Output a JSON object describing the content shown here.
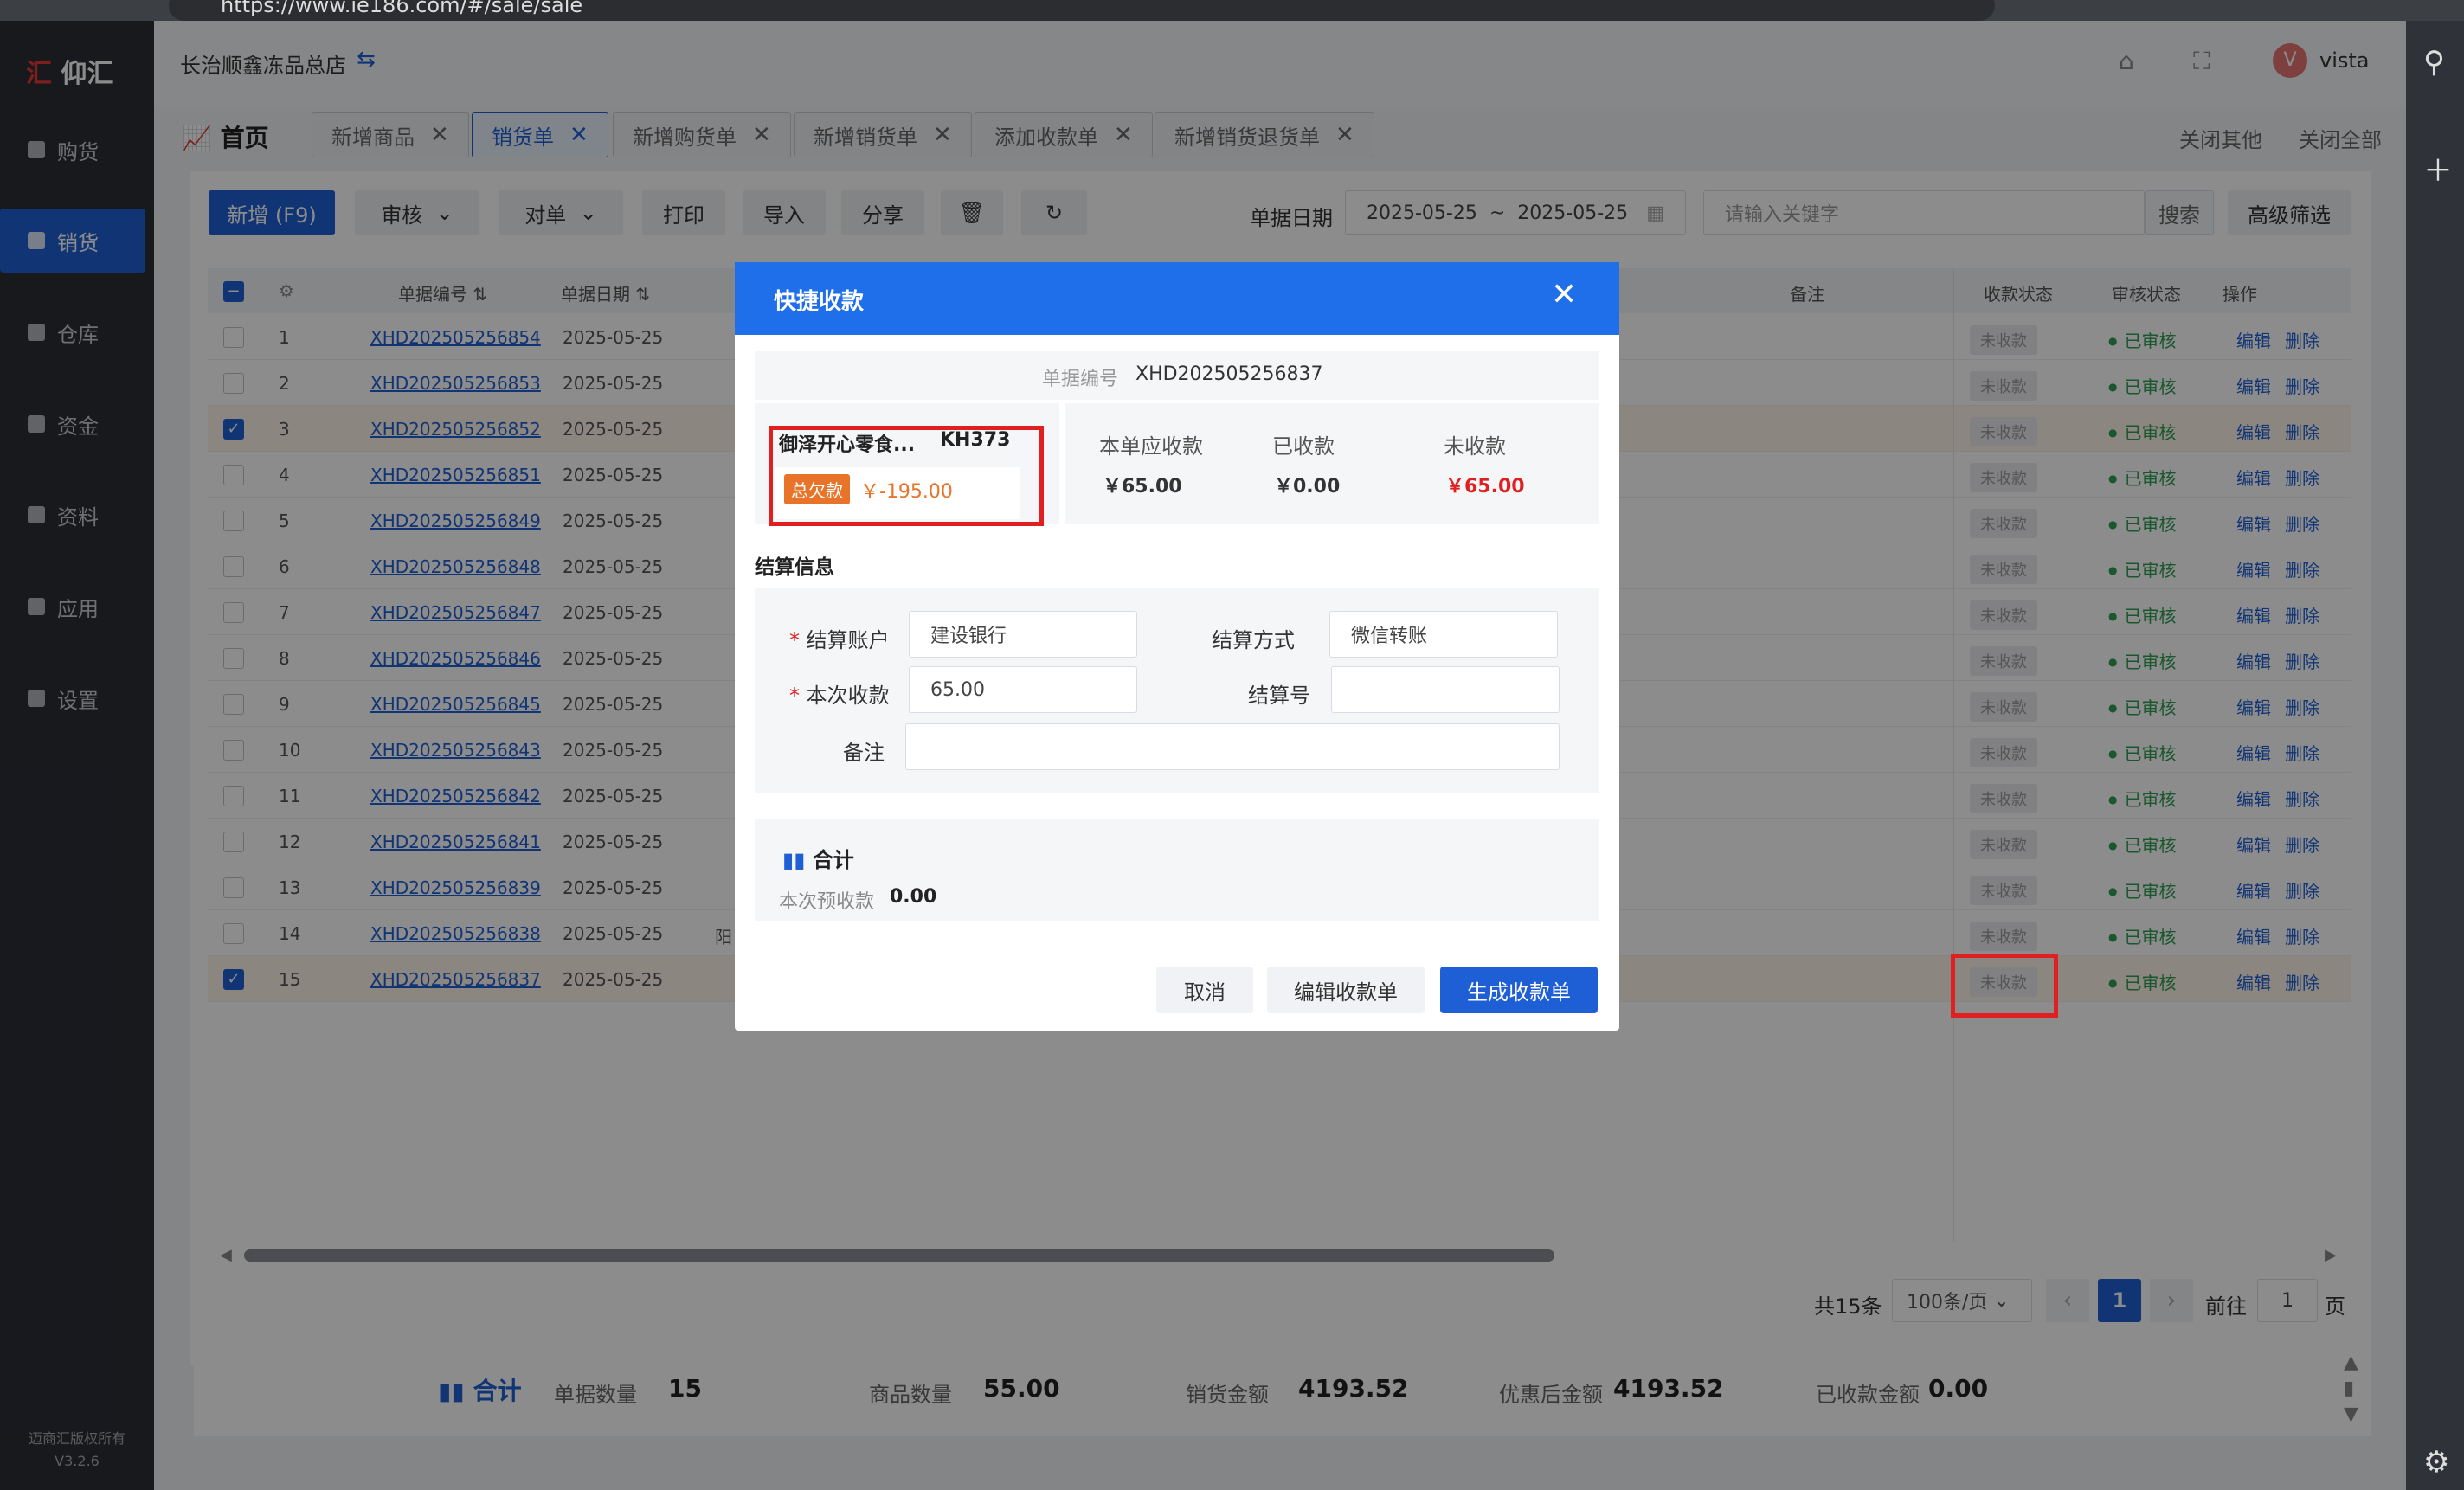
{
  "browser": {
    "url": "https://www.ie186.com/#/sale/sale"
  },
  "app": {
    "logo": "仰汇",
    "copyright": "迈商汇版权所有",
    "version": "V3.2.6"
  },
  "sidebar": {
    "items": [
      {
        "label": "购货"
      },
      {
        "label": "销货"
      },
      {
        "label": "仓库"
      },
      {
        "label": "资金"
      },
      {
        "label": "资料"
      },
      {
        "label": "应用"
      },
      {
        "label": "设置"
      }
    ]
  },
  "header": {
    "store": "长治顺鑫冻品总店",
    "user_initial": "V",
    "username": "vista"
  },
  "tabs": {
    "home": "首页",
    "items": [
      {
        "label": "新增商品"
      },
      {
        "label": "销货单"
      },
      {
        "label": "新增购货单"
      },
      {
        "label": "新增销货单"
      },
      {
        "label": "添加收款单"
      },
      {
        "label": "新增销货退货单"
      }
    ],
    "close_others": "关闭其他",
    "close_all": "关闭全部"
  },
  "toolbar": {
    "add": "新增 (F9)",
    "audit": "审核",
    "reconcile": "对单",
    "print": "打印",
    "import": "导入",
    "share": "分享",
    "date_label": "单据日期",
    "date_from": "2025-05-25",
    "date_sep": "~",
    "date_to": "2025-05-25",
    "keyword_placeholder": "请输入关键字",
    "search": "搜索",
    "advanced": "高级筛选"
  },
  "table": {
    "headers": {
      "no": "单据编号",
      "date": "单据日期",
      "remark": "备注",
      "pay_status": "收款状态",
      "audit_status": "审核状态",
      "ops": "操作"
    },
    "edit": "编辑",
    "delete": "删除",
    "status": "未收款",
    "audited": "已审核",
    "rows": [
      {
        "idx": "1",
        "no": "XHD202505256854",
        "date": "2025-05-25",
        "checked": false
      },
      {
        "idx": "2",
        "no": "XHD202505256853",
        "date": "2025-05-25",
        "checked": false
      },
      {
        "idx": "3",
        "no": "XHD202505256852",
        "date": "2025-05-25",
        "checked": true
      },
      {
        "idx": "4",
        "no": "XHD202505256851",
        "date": "2025-05-25",
        "checked": false
      },
      {
        "idx": "5",
        "no": "XHD202505256849",
        "date": "2025-05-25",
        "checked": false
      },
      {
        "idx": "6",
        "no": "XHD202505256848",
        "date": "2025-05-25",
        "checked": false
      },
      {
        "idx": "7",
        "no": "XHD202505256847",
        "date": "2025-05-25",
        "checked": false
      },
      {
        "idx": "8",
        "no": "XHD202505256846",
        "date": "2025-05-25",
        "checked": false
      },
      {
        "idx": "9",
        "no": "XHD202505256845",
        "date": "2025-05-25",
        "checked": false
      },
      {
        "idx": "10",
        "no": "XHD202505256843",
        "date": "2025-05-25",
        "checked": false
      },
      {
        "idx": "11",
        "no": "XHD202505256842",
        "date": "2025-05-25",
        "checked": false
      },
      {
        "idx": "12",
        "no": "XHD202505256841",
        "date": "2025-05-25",
        "checked": false
      },
      {
        "idx": "13",
        "no": "XHD202505256839",
        "date": "2025-05-25",
        "checked": false
      },
      {
        "idx": "14",
        "no": "XHD202505256838",
        "date": "2025-05-25",
        "checked": false,
        "remark": "阳"
      },
      {
        "idx": "15",
        "no": "XHD202505256837",
        "date": "2025-05-25",
        "checked": true
      }
    ]
  },
  "pagination": {
    "total": "共15条",
    "page_size": "100条/页",
    "current": "1",
    "goto_label": "前往",
    "goto_value": "1",
    "page_unit": "页"
  },
  "summary": {
    "title": "合计",
    "doc_count_label": "单据数量",
    "doc_count": "15",
    "qty_label": "商品数量",
    "qty": "55.00",
    "sales_label": "销货金额",
    "sales": "4193.52",
    "discounted_label": "优惠后金额",
    "discounted": "4193.52",
    "received_label": "已收款金额",
    "received": "0.00"
  },
  "modal": {
    "title": "快捷收款",
    "doc_no_label": "单据编号",
    "doc_no": "XHD202505256837",
    "customer": "御泽开心零食...",
    "customer_code": "KH373",
    "debt_badge": "总欠款",
    "debt": "￥-195.00",
    "receivable_label": "本单应收款",
    "receivable": "￥65.00",
    "received_label": "已收款",
    "received": "￥0.00",
    "unreceived_label": "未收款",
    "unreceived": "￥65.00",
    "settle_section": "结算信息",
    "account_label": "结算账户",
    "account": "建设银行",
    "method_label": "结算方式",
    "method": "微信转账",
    "amount_label": "本次收款",
    "amount": "65.00",
    "settle_no_label": "结算号",
    "settle_no": "",
    "remark_label": "备注",
    "remark": "",
    "total_title": "合计",
    "prepay_label": "本次预收款",
    "prepay": "0.00",
    "cancel": "取消",
    "edit": "编辑收款单",
    "generate": "生成收款单"
  },
  "colors": {
    "primary": "#1f5fd6",
    "sidebar": "#2a2e36",
    "danger": "#e02020",
    "success": "#2e9e55",
    "debt": "#e8742a"
  }
}
